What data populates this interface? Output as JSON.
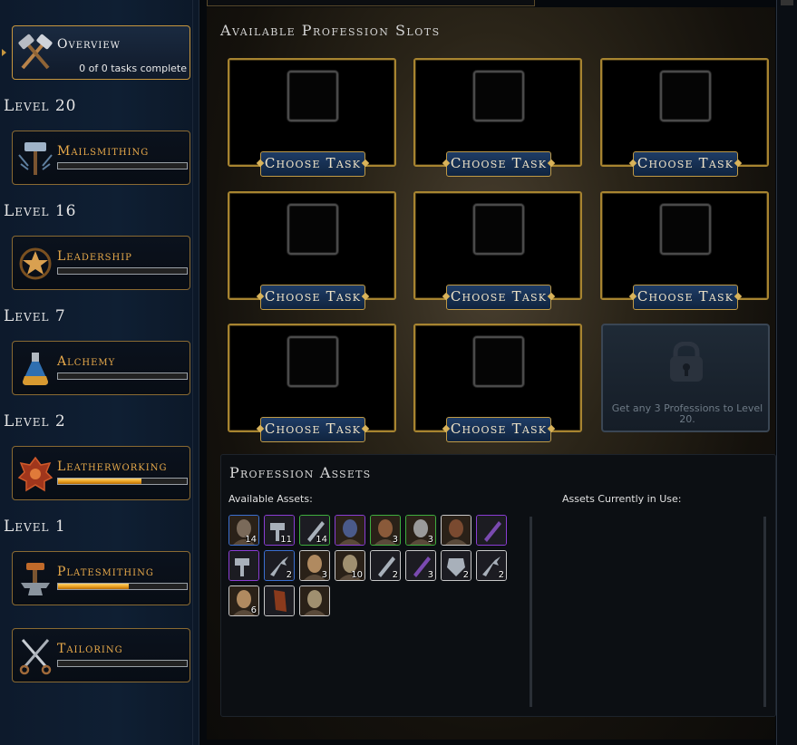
{
  "sidebar": {
    "overview": {
      "label": "Overview",
      "status": "0 of 0 tasks complete"
    },
    "groups": [
      {
        "level": "Level 20",
        "profession": "Mailsmithing",
        "icon": "hammer-anvil-icon",
        "progress": 0.0
      },
      {
        "level": "Level 16",
        "profession": "Leadership",
        "icon": "star-laurel-icon",
        "progress": 0.0
      },
      {
        "level": "Level 7",
        "profession": "Alchemy",
        "icon": "potion-flask-icon",
        "progress": 0.0
      },
      {
        "level": "Level 2",
        "profession": "Leatherworking",
        "icon": "leather-hide-icon",
        "progress": 0.65
      },
      {
        "level": "Level 1",
        "profession": "Platesmithing",
        "icon": "anvil-icon",
        "progress": 0.55
      },
      {
        "level": "",
        "profession": "Tailoring",
        "icon": "scissors-needle-icon",
        "progress": 0.0
      }
    ]
  },
  "slots": {
    "title": "Available Profession Slots",
    "button_label": "Choose Task",
    "count_open": 8,
    "locked_message": "Get any 3 Professions to Level 20."
  },
  "assets": {
    "title": "Profession Assets",
    "available_label": "Available Assets:",
    "in_use_label": "Assets Currently in Use:",
    "items": [
      {
        "icon": "soldier-portrait-icon",
        "rarity": "blue",
        "count": "14"
      },
      {
        "icon": "hammer-tool-icon",
        "rarity": "purple",
        "count": "11"
      },
      {
        "icon": "sword-tool-icon",
        "rarity": "green",
        "count": "14"
      },
      {
        "icon": "hooded-portrait-icon",
        "rarity": "purple",
        "count": ""
      },
      {
        "icon": "warrior-portrait-icon",
        "rarity": "green",
        "count": "3"
      },
      {
        "icon": "painted-face-portrait-icon",
        "rarity": "green",
        "count": "3"
      },
      {
        "icon": "bearded-portrait-icon",
        "rarity": "white",
        "count": ""
      },
      {
        "icon": "rod-tool-icon",
        "rarity": "purple",
        "count": ""
      },
      {
        "icon": "anvil-tool-icon",
        "rarity": "purple",
        "count": ""
      },
      {
        "icon": "tongs-tool-icon",
        "rarity": "blue",
        "count": "2"
      },
      {
        "icon": "bald-portrait-icon",
        "rarity": "white",
        "count": "3"
      },
      {
        "icon": "old-man-portrait-icon",
        "rarity": "white",
        "count": "10"
      },
      {
        "icon": "awl-tool-icon",
        "rarity": "white",
        "count": "2"
      },
      {
        "icon": "rod-tool-icon",
        "rarity": "white",
        "count": "3"
      },
      {
        "icon": "armor-tool-icon",
        "rarity": "white",
        "count": "2"
      },
      {
        "icon": "tongs-tool-icon",
        "rarity": "white",
        "count": "2"
      },
      {
        "icon": "bald-portrait-icon",
        "rarity": "white",
        "count": "6"
      },
      {
        "icon": "leather-tool-icon",
        "rarity": "white",
        "count": ""
      },
      {
        "icon": "old-man-portrait-icon",
        "rarity": "white",
        "count": ""
      }
    ]
  }
}
